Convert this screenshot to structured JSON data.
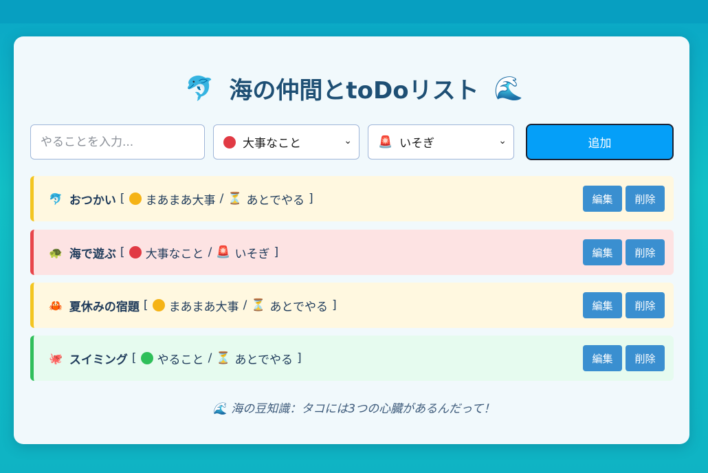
{
  "title": {
    "left_icon": "🐬",
    "text": "海の仲間とtoDoリスト",
    "right_icon": "🌊"
  },
  "form": {
    "input_placeholder": "やることを入力...",
    "priority": {
      "icon": "red-circle",
      "value": "大事なこと",
      "color": "#e13a44"
    },
    "urgency": {
      "icon": "🚨",
      "value": "いそぎ"
    },
    "add_label": "追加"
  },
  "tasks": [
    {
      "emoji": "🐬",
      "name": "おつかい",
      "open": "[",
      "priority_color": "#f5b316",
      "priority": "まあまあ大事",
      "sep": "/",
      "urgency_icon": "⏳",
      "urgency": "あとでやる",
      "close": "]",
      "edit": "編集",
      "del": "削除"
    },
    {
      "emoji": "🐢",
      "name": "海で遊ぶ",
      "open": "[",
      "priority_color": "#e13a44",
      "priority": "大事なこと",
      "sep": "/",
      "urgency_icon": "🚨",
      "urgency": "いそぎ",
      "close": "]",
      "edit": "編集",
      "del": "削除"
    },
    {
      "emoji": "🦀",
      "name": "夏休みの宿題",
      "open": "[",
      "priority_color": "#f5b316",
      "priority": "まあまあ大事",
      "sep": "/",
      "urgency_icon": "⏳",
      "urgency": "あとでやる",
      "close": "]",
      "edit": "編集",
      "del": "削除"
    },
    {
      "emoji": "🐙",
      "name": "スイミング",
      "open": "[",
      "priority_color": "#2fbf5a",
      "priority": "やること",
      "sep": "/",
      "urgency_icon": "⏳",
      "urgency": "あとでやる",
      "close": "]",
      "edit": "編集",
      "del": "削除"
    }
  ],
  "tip": {
    "icon": "🌊",
    "text": "海の豆知識：タコには3つの心臓があるんだって！"
  }
}
